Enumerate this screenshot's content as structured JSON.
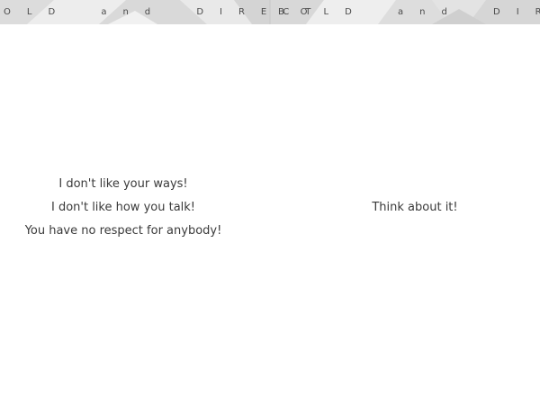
{
  "banner": {
    "left_text": "OLD and DIRECT",
    "right_text": "BOLD and DIREC"
  },
  "left_panel": {
    "lines": [
      "I don't like your ways!",
      "I don't like how you talk!",
      "You have no respect for anybody!"
    ]
  },
  "right_panel": {
    "text": "Think about it!"
  }
}
